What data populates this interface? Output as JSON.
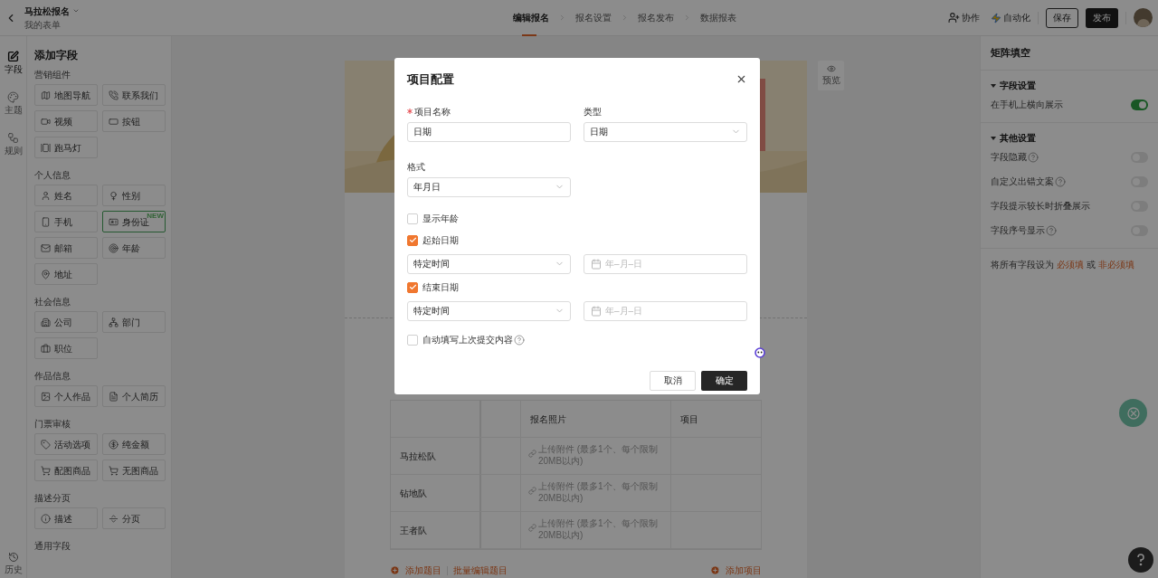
{
  "header": {
    "title": "马拉松报名",
    "subtitle": "我的表单",
    "steps": [
      {
        "label": "编辑报名",
        "selected": true
      },
      {
        "label": "报名设置",
        "selected": false
      },
      {
        "label": "报名发布",
        "selected": false
      },
      {
        "label": "数据报表",
        "selected": false
      }
    ],
    "collab": "协作",
    "automation": "自动化",
    "save": "保存",
    "publish": "发布"
  },
  "rail": [
    {
      "label": "字段",
      "selected": true
    },
    {
      "label": "主题",
      "selected": false
    },
    {
      "label": "规则",
      "selected": false
    }
  ],
  "rail_bottom": {
    "label": "历史"
  },
  "field_panel": {
    "title": "添加字段",
    "groups": [
      {
        "title": "营销组件",
        "items": [
          {
            "label": "地图导航"
          },
          {
            "label": "联系我们"
          },
          {
            "label": "视频"
          },
          {
            "label": "按钮"
          },
          {
            "label": "跑马灯"
          }
        ]
      },
      {
        "title": "个人信息",
        "items": [
          {
            "label": "姓名"
          },
          {
            "label": "性别"
          },
          {
            "label": "手机"
          },
          {
            "label": "身份证",
            "badge": "NEW"
          },
          {
            "label": "邮箱"
          },
          {
            "label": "年龄"
          },
          {
            "label": "地址"
          }
        ]
      },
      {
        "title": "社会信息",
        "items": [
          {
            "label": "公司"
          },
          {
            "label": "部门"
          },
          {
            "label": "职位"
          }
        ]
      },
      {
        "title": "作品信息",
        "items": [
          {
            "label": "个人作品"
          },
          {
            "label": "个人简历"
          }
        ]
      },
      {
        "title": "门票审核",
        "items": [
          {
            "label": "活动选项"
          },
          {
            "label": "纯金额"
          },
          {
            "label": "配图商品"
          },
          {
            "label": "无图商品"
          }
        ]
      },
      {
        "title": "描述分页",
        "items": [
          {
            "label": "描述"
          },
          {
            "label": "分页"
          }
        ]
      },
      {
        "title": "通用字段"
      }
    ]
  },
  "form": {
    "table": {
      "columns": [
        {
          "label": "报名照片"
        },
        {
          "label": "项目"
        }
      ],
      "rows": [
        {
          "name": "马拉松队",
          "upload": "上传附件 (最多1个、每个限制20MB以内)"
        },
        {
          "name": "钻地队",
          "upload": "上传附件 (最多1个、每个限制20MB以内)"
        },
        {
          "name": "王者队",
          "upload": "上传附件 (最多1个、每个限制20MB以内)"
        }
      ]
    },
    "add_question": "添加题目",
    "batch_edit": "批量编辑题目",
    "add_item": "添加项目"
  },
  "preview": "预览",
  "settings_panel": {
    "title": "矩阵填空",
    "sections": [
      {
        "title": "字段设置",
        "rows": [
          {
            "label": "在手机上横向展示",
            "help": false,
            "on": true
          }
        ]
      },
      {
        "title": "其他设置",
        "rows": [
          {
            "label": "字段隐藏",
            "help": true,
            "on": false
          },
          {
            "label": "自定义出错文案",
            "help": true,
            "on": false
          },
          {
            "label": "字段提示较长时折叠展示",
            "help": false,
            "on": false
          },
          {
            "label": "字段序号显示",
            "help": true,
            "on": false
          }
        ]
      }
    ],
    "footer": {
      "prefix": "将所有字段设为",
      "required": "必须填",
      "middle": "或",
      "optional": "非必须填"
    }
  },
  "dialog": {
    "title": "项目配置",
    "name": {
      "label": "项目名称",
      "required": true,
      "value": "日期"
    },
    "type": {
      "label": "类型",
      "value": "日期"
    },
    "format": {
      "label": "格式",
      "value": "年月日"
    },
    "show_age": {
      "label": "显示年龄",
      "checked": false
    },
    "start": {
      "label": "起始日期",
      "checked": true,
      "mode": "特定时间",
      "date_placeholder": "年–月–日"
    },
    "end": {
      "label": "结束日期",
      "checked": true,
      "mode": "特定时间",
      "date_placeholder": "年–月–日"
    },
    "autofill": {
      "label": "自动填写上次提交内容",
      "checked": false,
      "help": true
    },
    "cancel": "取消",
    "ok": "确定"
  }
}
